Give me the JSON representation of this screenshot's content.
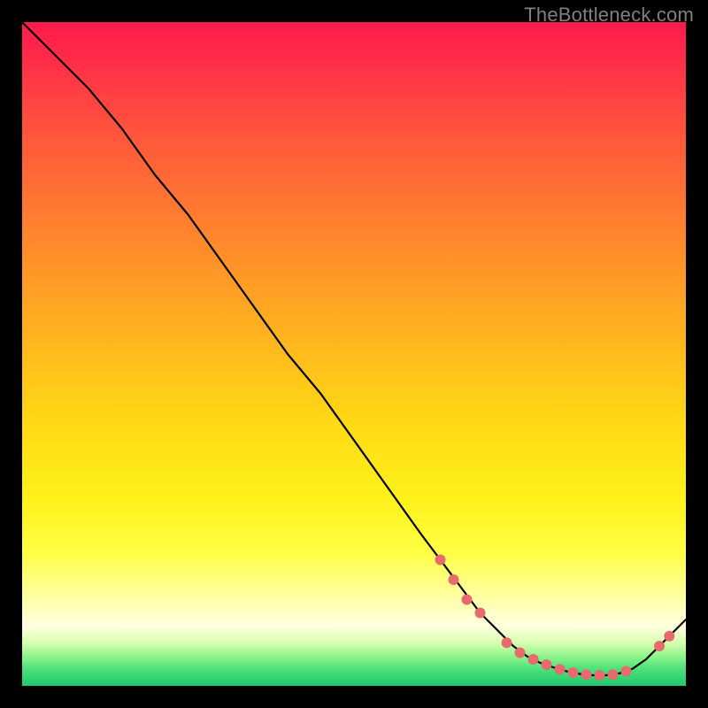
{
  "watermark": "TheBottleneck.com",
  "chart_data": {
    "type": "line",
    "title": "",
    "xlabel": "",
    "ylabel": "",
    "xlim": [
      0,
      100
    ],
    "ylim": [
      0,
      100
    ],
    "gradient": {
      "stops": [
        {
          "offset": 0.0,
          "color": "#ff1a4c"
        },
        {
          "offset": 0.05,
          "color": "#ff2a49"
        },
        {
          "offset": 0.15,
          "color": "#ff4f3e"
        },
        {
          "offset": 0.3,
          "color": "#ff7f2f"
        },
        {
          "offset": 0.45,
          "color": "#ffad20"
        },
        {
          "offset": 0.6,
          "color": "#ffd815"
        },
        {
          "offset": 0.72,
          "color": "#fff21a"
        },
        {
          "offset": 0.8,
          "color": "#ffff45"
        },
        {
          "offset": 0.87,
          "color": "#ffffaa"
        },
        {
          "offset": 0.91,
          "color": "#ffffe0"
        },
        {
          "offset": 0.935,
          "color": "#d8ffb0"
        },
        {
          "offset": 0.955,
          "color": "#90f58a"
        },
        {
          "offset": 0.975,
          "color": "#4be07a"
        },
        {
          "offset": 1.0,
          "color": "#1fc96e"
        }
      ]
    },
    "series": [
      {
        "name": "bottleneck-curve",
        "color": "#000000",
        "width": 2.2,
        "x": [
          0,
          3,
          6,
          10,
          15,
          20,
          25,
          30,
          35,
          40,
          45,
          50,
          55,
          60,
          63,
          66,
          69,
          72,
          74,
          76,
          78,
          80,
          82,
          84,
          86,
          88,
          90,
          92,
          94,
          96,
          98,
          100
        ],
        "y": [
          100,
          97,
          94,
          90,
          84,
          77,
          71,
          64,
          57,
          50,
          44,
          37,
          30,
          23,
          19,
          15,
          11,
          8,
          6,
          4.5,
          3.5,
          2.8,
          2.2,
          1.8,
          1.6,
          1.6,
          1.9,
          2.6,
          4,
          6,
          8,
          10
        ]
      }
    ],
    "markers": {
      "color": "#e86a6d",
      "radius": 6,
      "points": [
        {
          "x": 63,
          "y": 19
        },
        {
          "x": 65,
          "y": 16
        },
        {
          "x": 67,
          "y": 13
        },
        {
          "x": 69,
          "y": 11
        },
        {
          "x": 73,
          "y": 6.5
        },
        {
          "x": 75,
          "y": 5.0
        },
        {
          "x": 77,
          "y": 4.0
        },
        {
          "x": 79,
          "y": 3.2
        },
        {
          "x": 81,
          "y": 2.5
        },
        {
          "x": 83,
          "y": 2.0
        },
        {
          "x": 85,
          "y": 1.7
        },
        {
          "x": 87,
          "y": 1.6
        },
        {
          "x": 89,
          "y": 1.7
        },
        {
          "x": 91,
          "y": 2.2
        },
        {
          "x": 96,
          "y": 6.0
        },
        {
          "x": 97.5,
          "y": 7.5
        }
      ]
    }
  }
}
